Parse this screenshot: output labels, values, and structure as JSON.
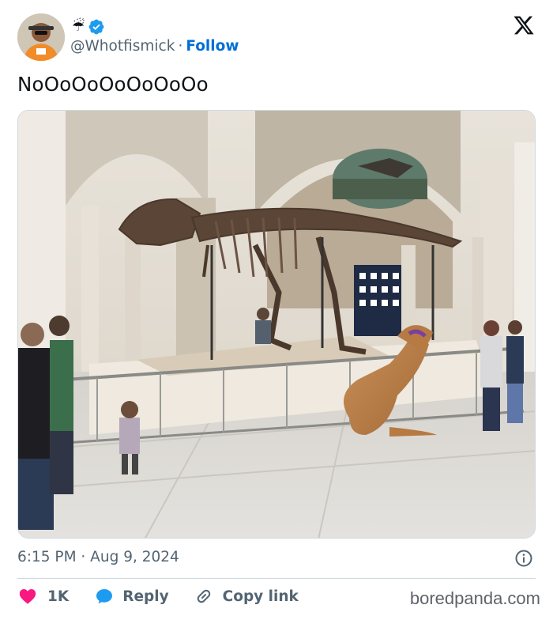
{
  "author": {
    "emoji": "☔",
    "handle": "@Whotfismick",
    "separator": "·",
    "follow_label": "Follow",
    "verified_color": "#1d9bf0"
  },
  "tweet": {
    "text": "NoOoOoOoOoOoOo"
  },
  "meta": {
    "timestamp": "6:15 PM · Aug 9, 2024"
  },
  "actions": {
    "likes": "1K",
    "reply_label": "Reply",
    "copy_label": "Copy link",
    "like_color": "#f91880",
    "reply_color": "#1d9bf0"
  },
  "watermark": "boredpanda.com",
  "icons": [
    "x-logo-icon",
    "verified-badge-icon",
    "heart-icon",
    "reply-bubble-icon",
    "link-icon",
    "info-icon"
  ]
}
